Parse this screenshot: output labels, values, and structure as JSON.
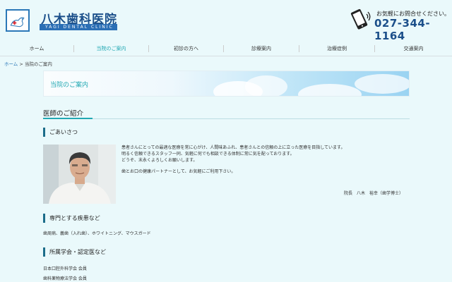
{
  "header": {
    "clinic_name": "八木歯科医院",
    "clinic_romaji": "YAGI DENTAL CLINIC",
    "phone_note": "お気軽にお問合せください。",
    "phone_number": "027-344-1164",
    "phone_icon": "smartphone-icon",
    "logo_icon": "bird-cross-icon"
  },
  "nav": {
    "items": [
      {
        "label": "ホーム"
      },
      {
        "label": "当院のご案内"
      },
      {
        "label": "初診の方へ"
      },
      {
        "label": "診療案内"
      },
      {
        "label": "治療症例"
      },
      {
        "label": "交通案内"
      }
    ],
    "active_index": 1
  },
  "breadcrumb": {
    "home": "ホーム",
    "separator": " > ",
    "current": "当院のご案内"
  },
  "banner": {
    "title": "当院のご案内"
  },
  "doctor_section": {
    "title": "医師のご紹介",
    "greeting_heading": "ごあいさつ",
    "greeting_lines": [
      "患者さんにとっての最適な医療を常に心がけ、人間味あふれ、患者さんとの信頼の上に立った医療を目指しています。",
      "明るく信頼できるスタッフ一同、気軽に何でも相談できる体制に常に気を配っております。",
      "どうぞ、末永くよろしくお願いします。",
      "歯とお口の健康パートナーとして、お気軽にご利用下さい。"
    ],
    "signature": "院長　八木　裕幸（歯学博士）",
    "specialty_heading": "専門とする疾患など",
    "specialty_text": "歯周病、義歯（入れ歯）、ホワイトニング、マウスガード",
    "society_heading": "所属学会・認定医など",
    "societies": [
      "日本口腔外科学会 会員",
      "歯科薬物療法学会 会員"
    ]
  },
  "colors": {
    "background": "#eaf9fb",
    "brand_blue": "#1b4f8a",
    "accent_teal": "#22a8b3",
    "heading_bar": "#1c6d8a"
  }
}
